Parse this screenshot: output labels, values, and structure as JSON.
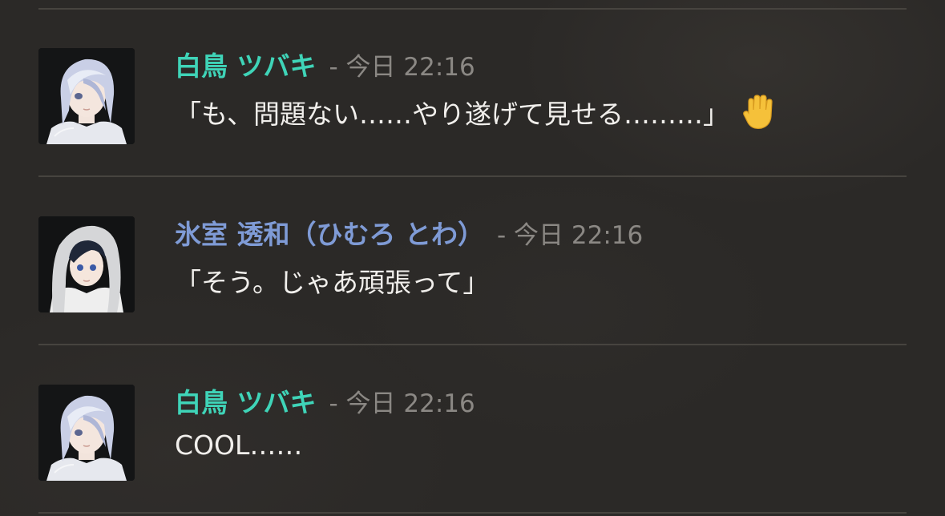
{
  "messages": [
    {
      "author": "白鳥 ツバキ",
      "separator": "-",
      "day": "今日",
      "time": "22:16",
      "text": "「も、問題ない……やり遂げて見せる………」",
      "reaction_icon": "raised-hand-icon",
      "author_color": "#3fd4b8"
    },
    {
      "author": "氷室 透和（ひむろ とわ）",
      "separator": "-",
      "day": "今日",
      "time": "22:16",
      "text": "「そう。じゃあ頑張って」",
      "author_color": "#7f9bd6"
    },
    {
      "author": "白鳥 ツバキ",
      "separator": "-",
      "day": "今日",
      "time": "22:16",
      "text": "COOL……",
      "author_color": "#3fd4b8"
    }
  ],
  "colors": {
    "background": "#2b2927",
    "divider": "#47443f",
    "timestamp": "#8b8884",
    "message_text": "#f1efec"
  }
}
